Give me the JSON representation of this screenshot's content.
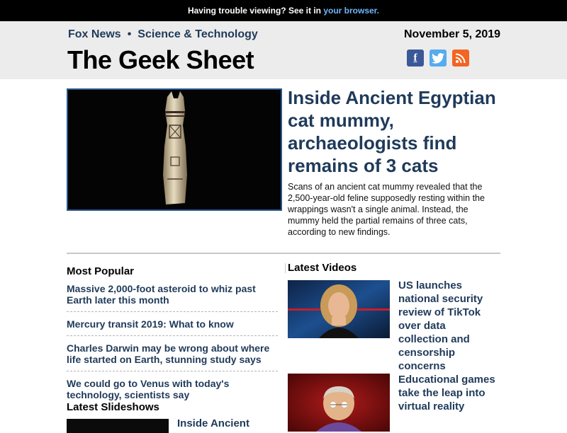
{
  "topbar": {
    "text": "Having trouble viewing? See it in ",
    "link": "your browser."
  },
  "header": {
    "crumb_1": "Fox News",
    "separator": "•",
    "crumb_2": "Science & Technology",
    "title": "The Geek Sheet",
    "date": "November 5, 2019",
    "social": {
      "facebook_glyph": "f",
      "facebook_icon": "facebook-icon",
      "twitter_icon": "twitter-icon",
      "rss_icon": "rss-icon"
    }
  },
  "hero": {
    "title": "Inside Ancient Egyptian cat mummy, archaeologists find remains of 3 cats",
    "description": "Scans of an ancient cat mummy revealed that the 2,500-year-old feline supposedly resting within the wrappings wasn't a single animal. Instead, the mummy held the partial remains of three cats, according to new findings."
  },
  "most_popular": {
    "heading": "Most Popular",
    "items": [
      "Massive 2,000-foot asteroid to whiz past Earth later this month",
      "Mercury transit 2019: What to know",
      "Charles Darwin may be wrong about where life started on Earth, stunning study says",
      "We could go to Venus with today's technology, scientists say"
    ]
  },
  "latest_slideshows": {
    "heading": "Latest Slideshows",
    "items": [
      "Inside Ancient"
    ]
  },
  "latest_videos": {
    "heading": "Latest Videos",
    "items": [
      "US launches national security review of TikTok over data collection and censorship concerns",
      "Educational games take the leap into virtual reality"
    ]
  },
  "colors": {
    "link": "#1f3a5a",
    "topbar_link": "#6fb6ff",
    "header_bg": "#ececec",
    "facebook": "#3b5998",
    "twitter": "#55acee",
    "rss": "#f26522"
  }
}
